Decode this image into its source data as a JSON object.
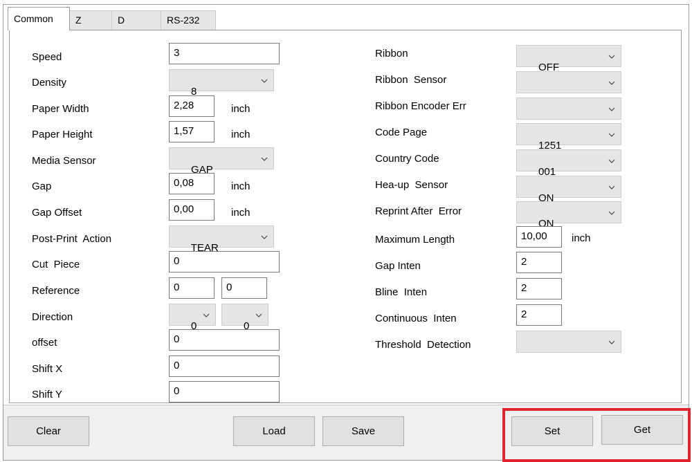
{
  "tabs": [
    {
      "label": "Common",
      "active": true
    },
    {
      "label": "Z"
    },
    {
      "label": "D"
    },
    {
      "label": "RS-232"
    }
  ],
  "fields": {
    "speed": {
      "label": "Speed",
      "value": "3"
    },
    "density": {
      "label": "Density",
      "value": "8"
    },
    "paper_width": {
      "label": "Paper Width",
      "value": "2,28",
      "unit": "inch"
    },
    "paper_height": {
      "label": "Paper Height",
      "value": "1,57",
      "unit": "inch"
    },
    "media_sensor": {
      "label": "Media Sensor",
      "value": "GAP"
    },
    "gap": {
      "label": "Gap",
      "value": "0,08",
      "unit": "inch"
    },
    "gap_offset": {
      "label": "Gap Offset",
      "value": "0,00",
      "unit": "inch"
    },
    "post_print_action": {
      "label": "Post-Print  Action",
      "value": "TEAR"
    },
    "cut_piece": {
      "label": "Cut  Piece",
      "value": "0"
    },
    "reference": {
      "label": "Reference",
      "value_x": "0",
      "value_y": "0"
    },
    "direction": {
      "label": "Direction",
      "value_a": "0",
      "value_b": "0"
    },
    "offset": {
      "label": "offset",
      "value": "0"
    },
    "shift_x": {
      "label": "Shift X",
      "value": "0"
    },
    "shift_y": {
      "label": "Shift Y",
      "value": "0"
    },
    "ribbon": {
      "label": "Ribbon",
      "value": "OFF"
    },
    "ribbon_sensor": {
      "label": "Ribbon  Sensor",
      "value": ""
    },
    "ribbon_encoder_err": {
      "label": "Ribbon Encoder Err",
      "value": ""
    },
    "code_page": {
      "label": "Code Page",
      "value": "1251"
    },
    "country_code": {
      "label": "Country Code",
      "value": "001"
    },
    "head_up_sensor": {
      "label": "Hea-up  Sensor",
      "value": "ON"
    },
    "reprint_after_error": {
      "label": "Reprint After  Error",
      "value": "ON"
    },
    "maximum_length": {
      "label": "Maximum Length",
      "value": "10,00",
      "unit": "inch"
    },
    "gap_inten": {
      "label": "Gap Inten",
      "value": "2"
    },
    "bline_inten": {
      "label": "Bline  Inten",
      "value": "2"
    },
    "continuous_inten": {
      "label": "Continuous  Inten",
      "value": "2"
    },
    "threshold_detection": {
      "label": "Threshold  Detection",
      "value": ""
    }
  },
  "buttons": {
    "clear": "Clear",
    "load": "Load",
    "save": "Save",
    "set": "Set",
    "get": "Get"
  },
  "colors": {
    "highlight": "#e0232d",
    "dropdown_bg": "#e5e5e5",
    "button_bg": "#e1e1e1"
  },
  "icons": {
    "dropdown": "chevron-down-icon"
  }
}
